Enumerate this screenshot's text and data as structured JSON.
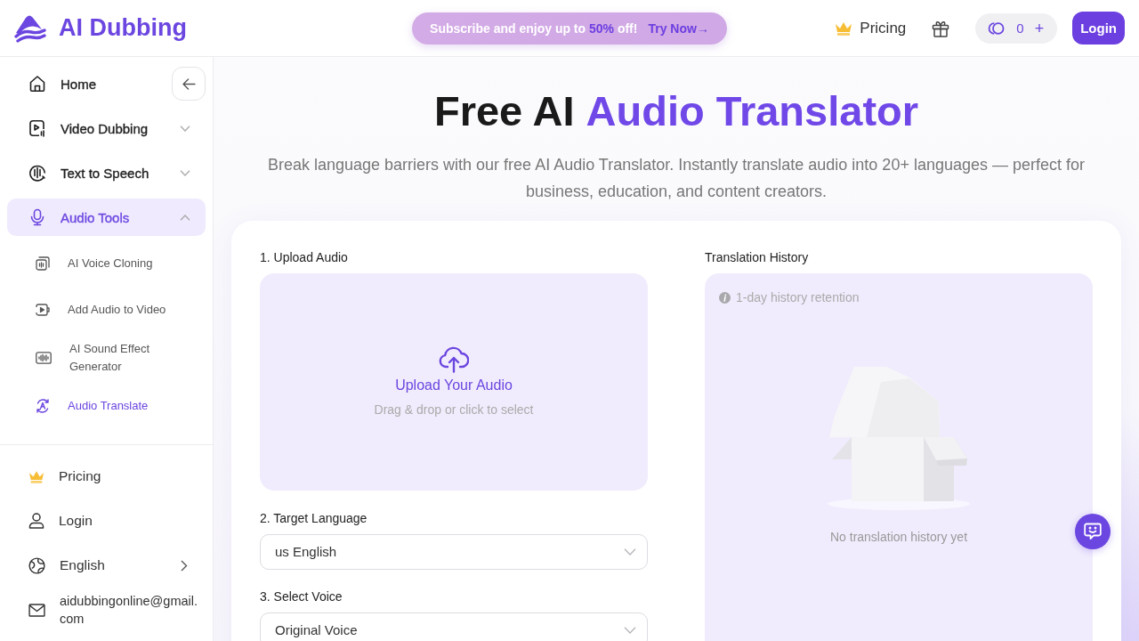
{
  "header": {
    "logo": "AI Dubbing",
    "promo": {
      "text": "Subscribe and enjoy up to **50%** off!",
      "link": "Try Now→"
    },
    "pricing": "Pricing",
    "credits": {
      "count": "0",
      "add": "+"
    },
    "login": "Login"
  },
  "sidebar": {
    "nav": [
      {
        "label": "Home",
        "kind": "link",
        "selected": false
      },
      {
        "label": "Video Dubbing",
        "kind": "group",
        "selected": false,
        "expanded": false
      },
      {
        "label": "Text to Speech",
        "kind": "group",
        "selected": false,
        "expanded": false
      },
      {
        "label": "Audio Tools",
        "kind": "group",
        "selected": true,
        "expanded": true,
        "children": [
          {
            "label": "AI Voice Cloning",
            "selected": false
          },
          {
            "label": "Add Audio to Video",
            "selected": false
          },
          {
            "label": "AI Sound Effect Generator",
            "selected": false
          },
          {
            "label": "Audio Translate",
            "selected": true
          }
        ]
      }
    ],
    "footer": [
      {
        "label": "Pricing",
        "kind": "link"
      },
      {
        "label": "Login",
        "kind": "link"
      },
      {
        "label": "English",
        "kind": "submenu"
      },
      {
        "label": "aidubbingonline@gmail.com",
        "kind": "contact"
      }
    ]
  },
  "hero": {
    "title": "Free AI **Audio Translator**",
    "subtitle": "Break language barriers with our free AI Audio Translator. Instantly translate audio into 20+ languages — perfect for business, education, and content creators."
  },
  "translator": {
    "upload": {
      "label": "1. Upload Audio",
      "title": "Upload Your Audio",
      "hint": "Drag & drop or click to select"
    },
    "language": {
      "label": "2. Target Language",
      "value": "us English"
    },
    "voice": {
      "label": "3. Select Voice",
      "value": "Original Voice"
    },
    "history": {
      "title": "Translation History",
      "note": "1-day history retention",
      "empty": "No translation history yet"
    }
  }
}
